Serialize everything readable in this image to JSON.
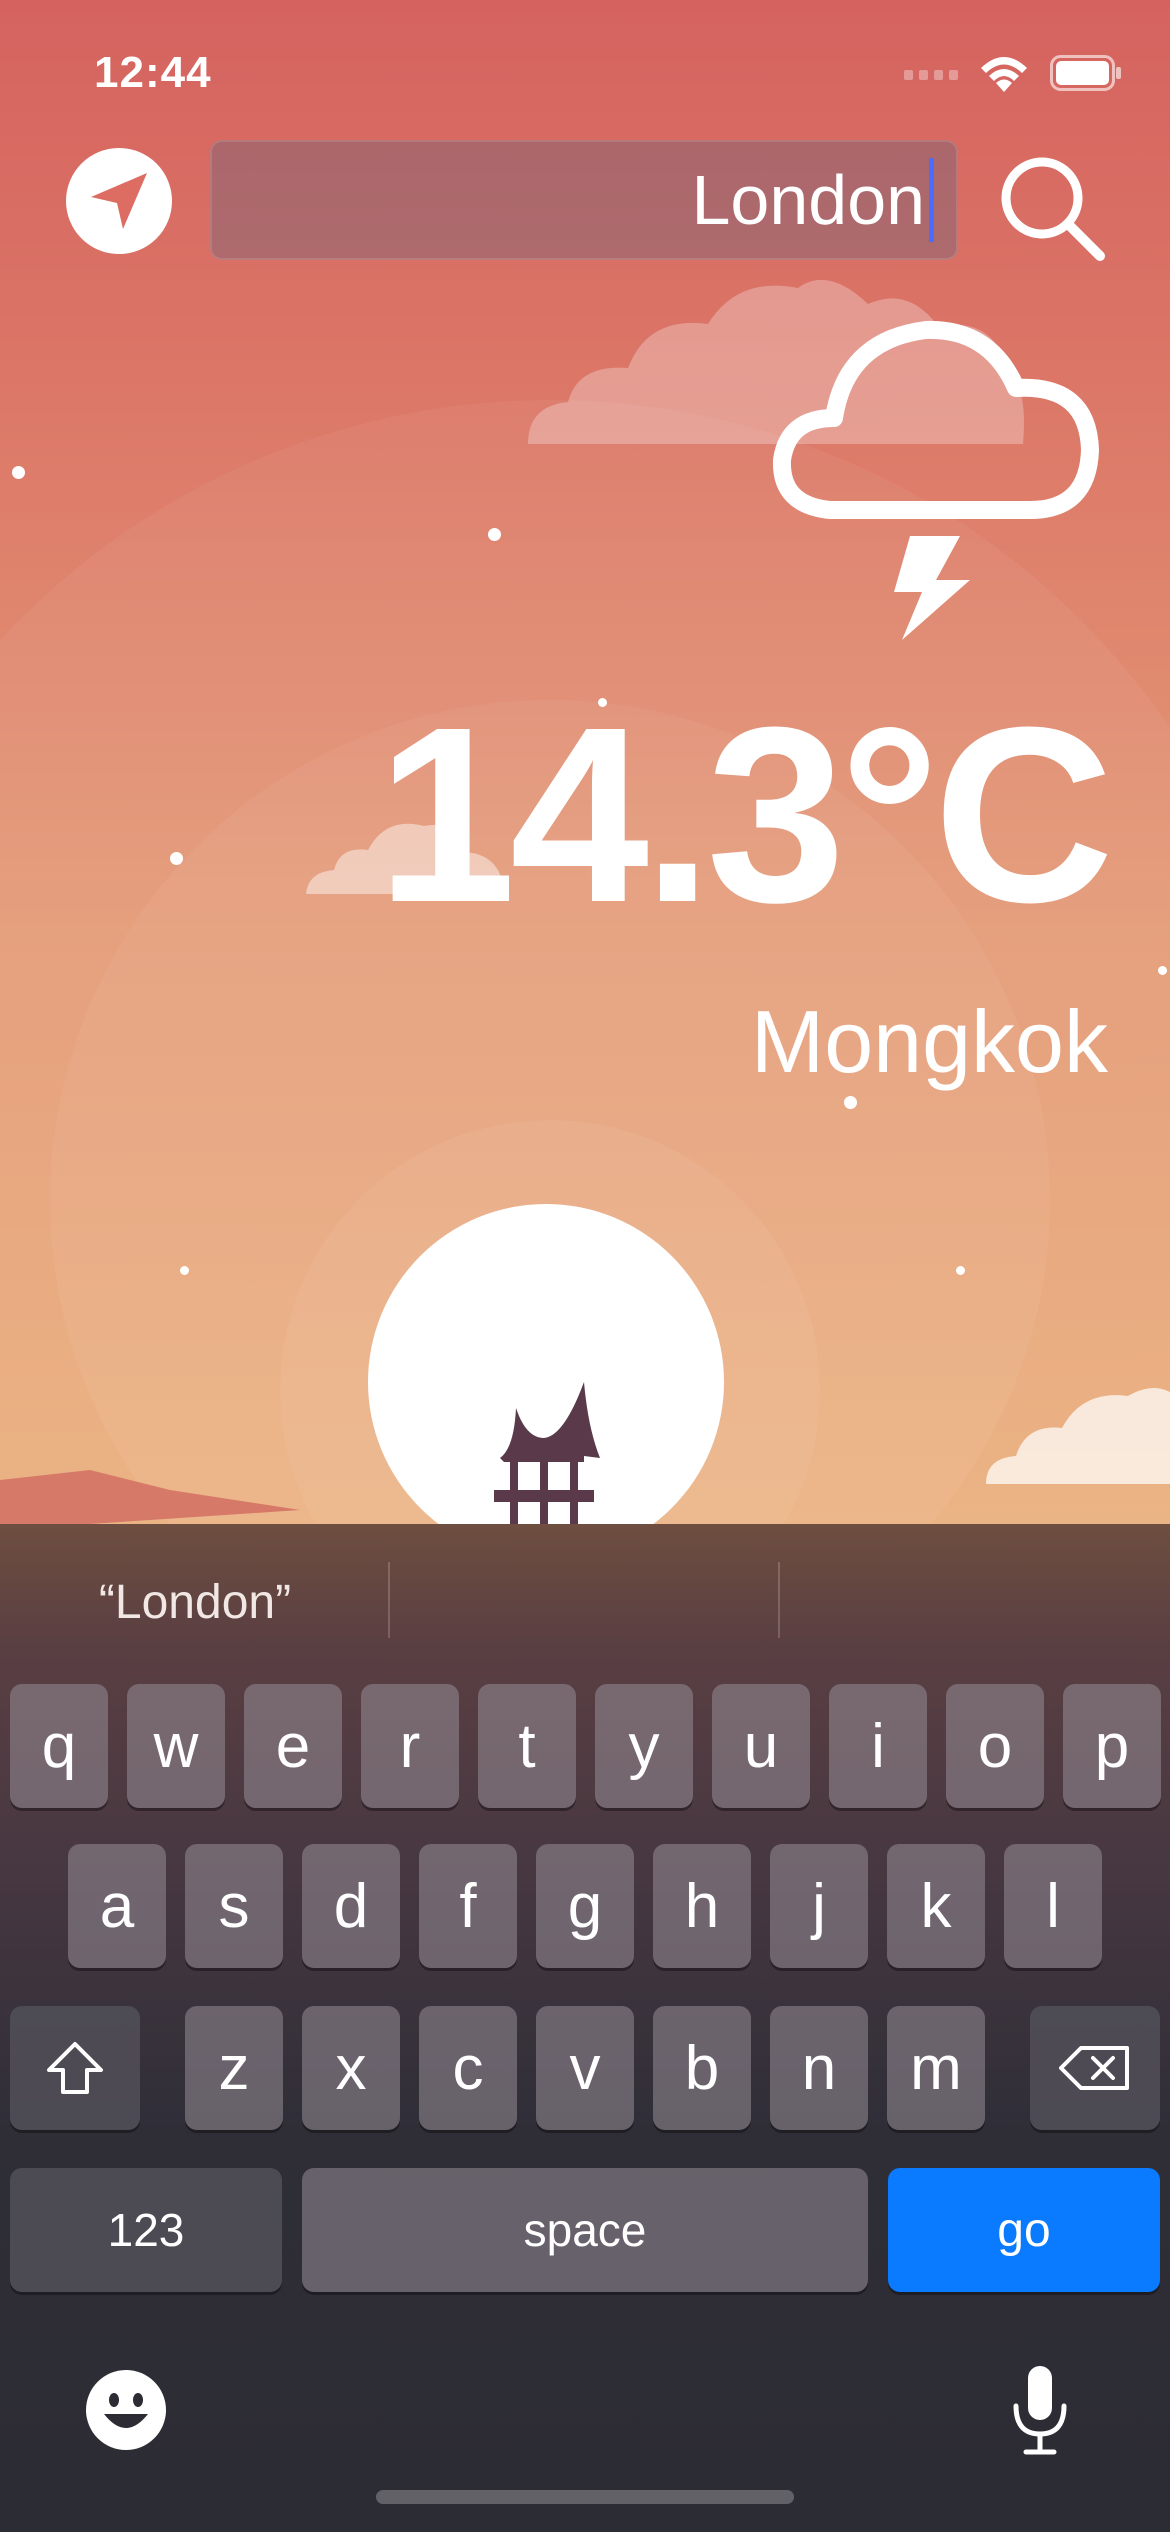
{
  "status_bar": {
    "time": "12:44"
  },
  "header": {
    "location_icon": "location-arrow-icon",
    "search_value": "London",
    "search_icon": "search-icon"
  },
  "weather": {
    "icon": "cloud-lightning-icon",
    "temperature": "14.3°C",
    "city": "Mongkok"
  },
  "keyboard": {
    "suggestions": [
      "“London”",
      "",
      ""
    ],
    "row1": [
      "q",
      "w",
      "e",
      "r",
      "t",
      "y",
      "u",
      "i",
      "o",
      "p"
    ],
    "row2": [
      "a",
      "s",
      "d",
      "f",
      "g",
      "h",
      "j",
      "k",
      "l"
    ],
    "row3": [
      "z",
      "x",
      "c",
      "v",
      "b",
      "n",
      "m"
    ],
    "numbers_label": "123",
    "space_label": "space",
    "go_label": "go",
    "shift_icon": "shift-icon",
    "delete_icon": "backspace-icon",
    "emoji_icon": "emoji-icon",
    "mic_icon": "microphone-icon"
  },
  "colors": {
    "sky_top": "#d5625f",
    "sky_bottom": "#eab07e",
    "go_key": "#0a7aff",
    "caret": "#4a6cff"
  }
}
